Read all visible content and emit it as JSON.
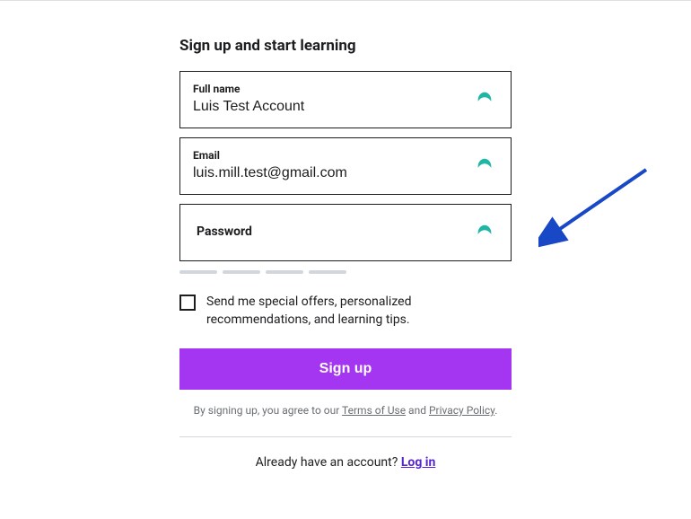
{
  "heading": "Sign up and start learning",
  "fields": {
    "fullname": {
      "label": "Full name",
      "value": "Luis Test Account"
    },
    "email": {
      "label": "Email",
      "value": "luis.mill.test@gmail.com"
    },
    "password": {
      "label": "Password",
      "value": ""
    }
  },
  "checkbox_label": "Send me special offers, personalized recommendations, and learning tips.",
  "signup_button": "Sign up",
  "terms_prefix": "By signing up, you agree to our ",
  "terms_link1": "Terms of Use",
  "terms_mid": " and ",
  "terms_link2": "Privacy Policy",
  "terms_suffix": ".",
  "login_prompt": "Already have an account? ",
  "login_link": "Log in",
  "colors": {
    "primary": "#a435f0",
    "accent_teal": "#1fb6a5",
    "link_purple": "#5624d0"
  }
}
